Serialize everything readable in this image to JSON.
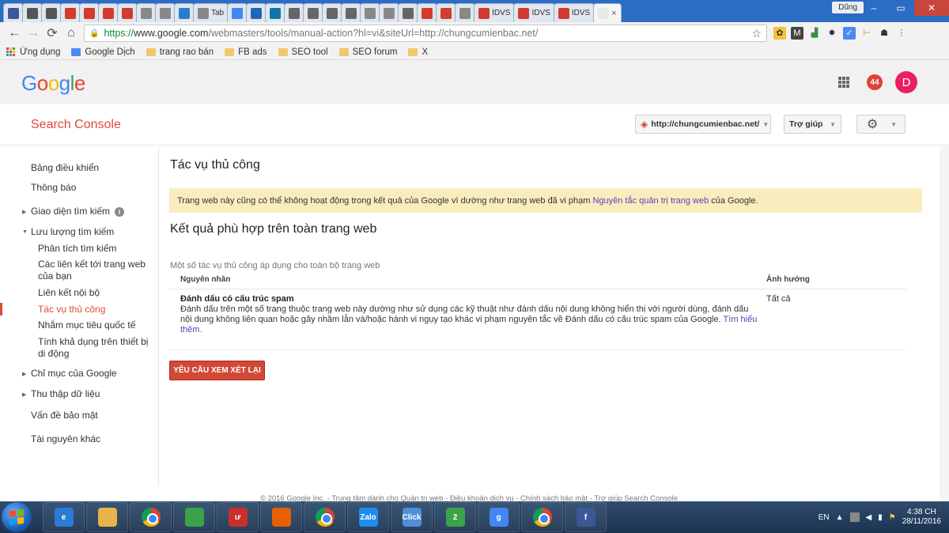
{
  "browser": {
    "tabs": [
      {
        "icon": "facebook-icon",
        "color": "#3b5998",
        "text": ""
      },
      {
        "icon": "user-icon",
        "color": "#555555",
        "text": ""
      },
      {
        "icon": "user-icon",
        "color": "#555555",
        "text": ""
      },
      {
        "icon": "red-diamond-icon",
        "color": "#d33b2c",
        "text": ""
      },
      {
        "icon": "red-diamond-icon",
        "color": "#d33b2c",
        "text": ""
      },
      {
        "icon": "red-diamond-icon",
        "color": "#d33b2c",
        "text": ""
      },
      {
        "icon": "red-diamond-icon",
        "color": "#d33b2c",
        "text": ""
      },
      {
        "icon": "doc-icon",
        "color": "#888888",
        "text": ""
      },
      {
        "icon": "doc-icon",
        "color": "#888888",
        "text": ""
      },
      {
        "icon": "ie-icon",
        "color": "#2a7bd3",
        "text": ""
      },
      {
        "icon": "tab-icon",
        "color": "#888888",
        "text": "Tab"
      },
      {
        "icon": "google-g-icon",
        "color": "#4285f4",
        "text": ""
      },
      {
        "icon": "alexa-icon",
        "color": "#1f66b3",
        "text": ""
      },
      {
        "icon": "linkedin-icon",
        "color": "#0e76a8",
        "text": ""
      },
      {
        "icon": "wheel-icon",
        "color": "#666666",
        "text": ""
      },
      {
        "icon": "wheel-icon",
        "color": "#666666",
        "text": ""
      },
      {
        "icon": "wheel-icon",
        "color": "#666666",
        "text": ""
      },
      {
        "icon": "wheel-icon",
        "color": "#666666",
        "text": ""
      },
      {
        "icon": "doc-icon",
        "color": "#888888",
        "text": ""
      },
      {
        "icon": "doc-icon",
        "color": "#888888",
        "text": ""
      },
      {
        "icon": "wheel-icon",
        "color": "#666666",
        "text": ""
      },
      {
        "icon": "red-diamond-icon",
        "color": "#d33b2c",
        "text": ""
      },
      {
        "icon": "red-diamond-icon",
        "color": "#d33b2c",
        "text": ""
      },
      {
        "icon": "doc-icon",
        "color": "#888888",
        "text": ""
      },
      {
        "icon": "idvs-icon",
        "color": "#d33b2c",
        "text": "IDVS"
      },
      {
        "icon": "idvs-icon",
        "color": "#d33b2c",
        "text": "IDVS"
      },
      {
        "icon": "idvs-icon",
        "color": "#d33b2c",
        "text": "IDVS"
      }
    ],
    "active_tab_close": "×",
    "user_label": "Dũng",
    "url_scheme": "https://",
    "url_host": "www.google.com",
    "url_path": "/webmasters/tools/manual-action?hl=vi&siteUrl=http://chungcumienbac.net/",
    "bookmarks": [
      {
        "label": "Ứng dụng",
        "kind": "apps"
      },
      {
        "label": "Google Dịch",
        "kind": "translate"
      },
      {
        "label": "trang rao bán",
        "kind": "folder"
      },
      {
        "label": "FB ads",
        "kind": "folder"
      },
      {
        "label": "SEO tool",
        "kind": "folder"
      },
      {
        "label": "SEO forum",
        "kind": "folder"
      },
      {
        "label": "X",
        "kind": "folder"
      }
    ]
  },
  "google": {
    "logo_letters": [
      {
        "ch": "G",
        "color": "#4285f4"
      },
      {
        "ch": "o",
        "color": "#ea4335"
      },
      {
        "ch": "o",
        "color": "#fbbc05"
      },
      {
        "ch": "g",
        "color": "#4285f4"
      },
      {
        "ch": "l",
        "color": "#34a853"
      },
      {
        "ch": "e",
        "color": "#ea4335"
      }
    ],
    "notification_count": "44",
    "avatar_letter": "D"
  },
  "console": {
    "title": "Search Console",
    "site": "http://chungcumienbac.net/",
    "help": "Trợ giúp"
  },
  "sidebar": {
    "items": [
      {
        "label": "Bảng điều khiển",
        "type": "top"
      },
      {
        "label": "Thông báo",
        "type": "top"
      },
      {
        "label": "Giao diện tìm kiếm",
        "type": "collapsed"
      },
      {
        "label": "Lưu lượng tìm kiếm",
        "type": "expanded"
      },
      {
        "label": "Phân tích tìm kiếm",
        "type": "sub"
      },
      {
        "label": "Các liên kết tới trang web của bạn",
        "type": "sub"
      },
      {
        "label": "Liên kết nội bộ",
        "type": "sub"
      },
      {
        "label": "Tác vụ thủ công",
        "type": "sub-active"
      },
      {
        "label": "Nhắm mục tiêu quốc tế",
        "type": "sub"
      },
      {
        "label": "Tính khả dụng trên thiết bị di động",
        "type": "sub"
      },
      {
        "label": "Chỉ mục của Google",
        "type": "collapsed"
      },
      {
        "label": "Thu thập dữ liệu",
        "type": "collapsed"
      },
      {
        "label": "Vấn đề bảo mật",
        "type": "top"
      },
      {
        "label": "Tài nguyên khác",
        "type": "top"
      }
    ]
  },
  "main": {
    "heading": "Tác vụ thủ công",
    "notice_prefix": "Trang web này cũng có thể không hoạt động trong kết quả của Google vì dường như trang web đã vi phạm ",
    "notice_link": "Nguyên tắc quản trị trang web",
    "notice_suffix": " của Google.",
    "section_heading": "Kết quả phù hợp trên toàn trang web",
    "section_desc": "Một số tác vụ thủ công áp dụng cho toàn bộ trang web",
    "col_reason": "Nguyên nhân",
    "col_impact": "Ảnh hưởng",
    "row_title": "Đánh dấu có cấu trúc spam",
    "row_text": "Đánh dấu trên một số trang thuộc trang web này dường như sử dụng các kỹ thuật như đánh dấu nội dung không hiển thị với người dùng, đánh dấu nội dung không liên quan hoặc gây nhầm lẫn và/hoặc hành vi ngụy tạo khác vi phạm nguyên tắc về Đánh dấu có cấu trúc spam của Google. ",
    "row_link": "Tìm hiểu thêm.",
    "row_impact": "Tất cả",
    "review_button": "YÊU CẦU XEM XÉT LẠI"
  },
  "footer": {
    "text": "© 2016 Google Inc. - Trung tâm dành cho Quản trị web - Điều khoản dịch vụ - Chính sách bảo mật - Trợ giúp Search Console"
  },
  "taskbar": {
    "apps": [
      {
        "icon": "ie-icon",
        "color": "#2a7bd3",
        "text": "e"
      },
      {
        "icon": "explorer-icon",
        "color": "#e8b34b",
        "text": ""
      },
      {
        "icon": "chrome-icon",
        "color": "",
        "text": ""
      },
      {
        "icon": "coccoc-icon",
        "color": "#3aa34a",
        "text": ""
      },
      {
        "icon": "unikey-icon",
        "color": "#c8302a",
        "text": "ư"
      },
      {
        "icon": "firefox-icon",
        "color": "#e66000",
        "text": ""
      },
      {
        "icon": "chrome-icon",
        "color": "",
        "text": ""
      },
      {
        "icon": "zalo-icon",
        "color": "#1f8cf0",
        "text": "Zalo"
      },
      {
        "icon": "click-icon",
        "color": "#4f8fd8",
        "text": "Click"
      },
      {
        "icon": "l2-icon",
        "color": "#3aa34a",
        "text": "2"
      },
      {
        "icon": "google-icon",
        "color": "#4285f4",
        "text": "g"
      },
      {
        "icon": "chrome-icon",
        "color": "",
        "text": ""
      },
      {
        "icon": "facebook-icon",
        "color": "#3b5998",
        "text": "f"
      }
    ],
    "lang": "EN",
    "time": "4:38 CH",
    "date": "28/11/2016"
  }
}
